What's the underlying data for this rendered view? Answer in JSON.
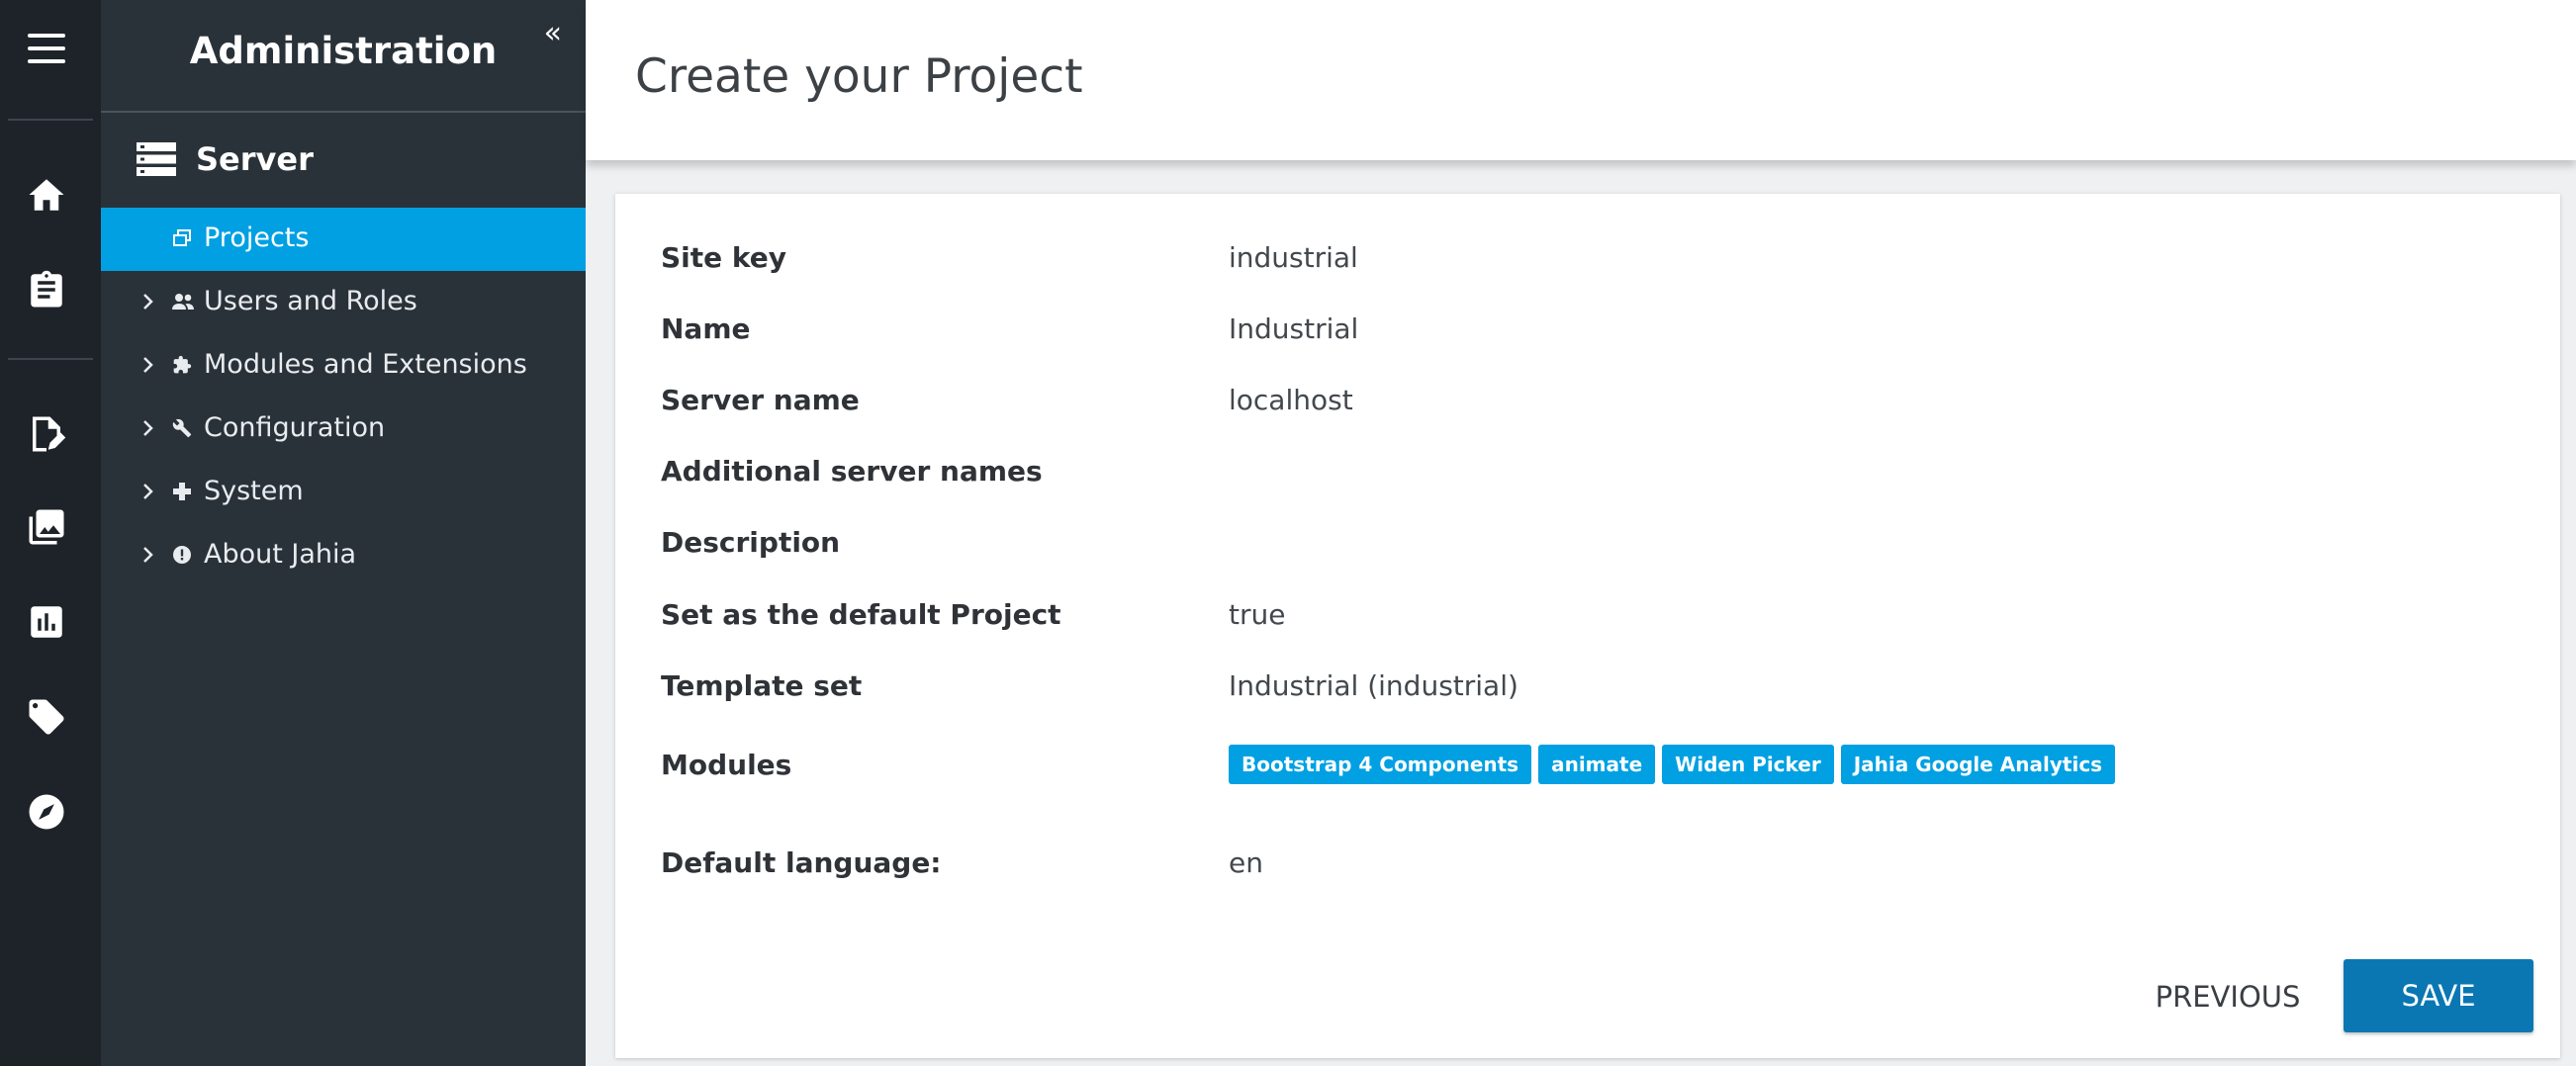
{
  "rail": {
    "icons": [
      "menu-icon",
      "home-icon",
      "clipboard-icon",
      "edit-page-icon",
      "media-icon",
      "analytics-icon",
      "tag-icon",
      "compass-icon"
    ]
  },
  "panel": {
    "title": "Administration",
    "section": "Server",
    "items": [
      {
        "label": "Projects",
        "icon": "projects-icon",
        "active": true
      },
      {
        "label": "Users and Roles",
        "icon": "users-icon"
      },
      {
        "label": "Modules and Extensions",
        "icon": "puzzle-icon"
      },
      {
        "label": "Configuration",
        "icon": "wrench-icon"
      },
      {
        "label": "System",
        "icon": "system-icon"
      },
      {
        "label": "About Jahia",
        "icon": "info-icon"
      }
    ]
  },
  "page": {
    "title": "Create your Project"
  },
  "form": {
    "site_key": {
      "label": "Site key",
      "value": "industrial"
    },
    "name": {
      "label": "Name",
      "value": "Industrial"
    },
    "server_name": {
      "label": "Server name",
      "value": "localhost"
    },
    "additional_server_names": {
      "label": "Additional server names",
      "value": ""
    },
    "description": {
      "label": "Description",
      "value": ""
    },
    "default_project": {
      "label": "Set as the default Project",
      "value": "true"
    },
    "template_set": {
      "label": "Template set",
      "value": "Industrial (industrial)"
    },
    "modules": {
      "label": "Modules",
      "tags": [
        "Bootstrap 4 Components",
        "animate",
        "Widen Picker",
        "Jahia Google Analytics"
      ]
    },
    "default_language": {
      "label": "Default language:",
      "value": "en"
    }
  },
  "actions": {
    "previous": "PREVIOUS",
    "save": "SAVE"
  },
  "colors": {
    "accent": "#00a0e3",
    "save_button": "#0a77b3",
    "rail_bg": "#1d2329",
    "panel_bg": "#2a3239"
  }
}
